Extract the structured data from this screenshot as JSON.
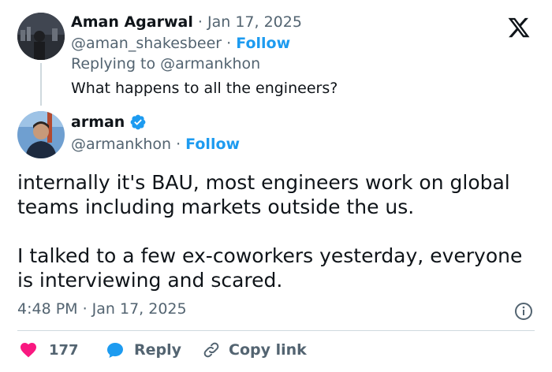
{
  "quoted": {
    "author_name": "Aman Agarwal",
    "date": "Jan 17, 2025",
    "handle": "@aman_shakesbeer",
    "follow_label": "Follow",
    "replying_to": "Replying to @armankhon",
    "text": "What happens to all the engineers?"
  },
  "main": {
    "author_name": "arman",
    "handle": "@armankhon",
    "follow_label": "Follow",
    "paragraph1_line1": "internally it's BAU, most engineers work on global",
    "paragraph1_line2": "teams including markets outside the us.",
    "paragraph2_line1": "I talked to a few ex-coworkers yesterday, everyone",
    "paragraph2_line2": "is interviewing and scared.",
    "timestamp": "4:48 PM · Jan 17, 2025"
  },
  "actions": {
    "like_count": "177",
    "reply_label": "Reply",
    "copy_link_label": "Copy link"
  },
  "colors": {
    "accent": "#1d9bf0",
    "like": "#f91880",
    "muted": "#536471",
    "divider": "#cfd9de"
  },
  "icons": {
    "x_logo": "x-logo-icon",
    "verified": "verified-badge-icon",
    "info": "info-icon",
    "heart": "heart-icon",
    "reply": "reply-icon",
    "link": "link-icon"
  }
}
